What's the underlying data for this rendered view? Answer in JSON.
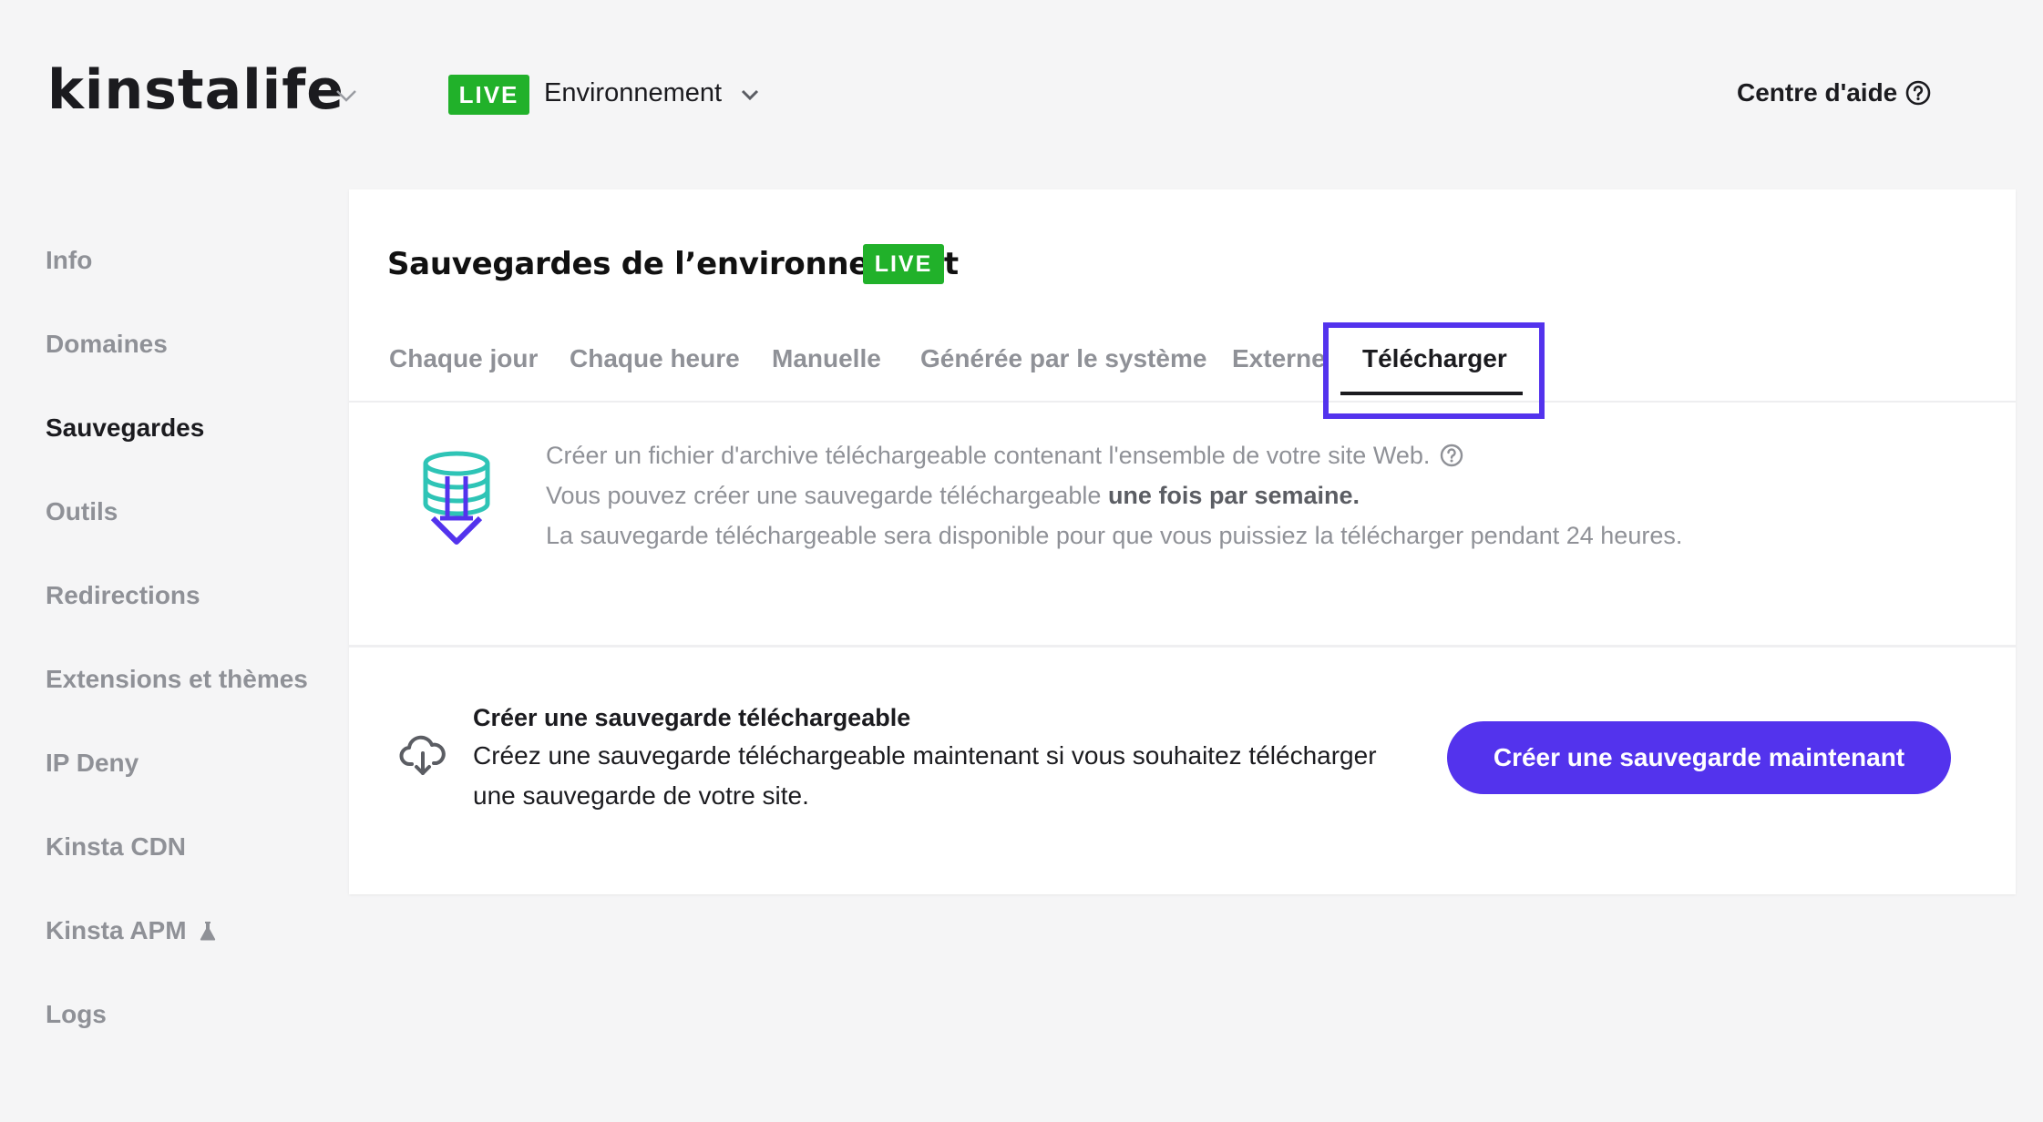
{
  "header": {
    "logo": "kinstalife",
    "live_badge": "LIVE",
    "environment_label": "Environnement",
    "help_label": "Centre d'aide"
  },
  "sidebar": {
    "items": [
      {
        "label": "Info"
      },
      {
        "label": "Domaines"
      },
      {
        "label": "Sauvegardes"
      },
      {
        "label": "Outils"
      },
      {
        "label": "Redirections"
      },
      {
        "label": "Extensions et thèmes"
      },
      {
        "label": "IP Deny"
      },
      {
        "label": "Kinsta CDN"
      },
      {
        "label": "Kinsta APM"
      },
      {
        "label": "Logs"
      }
    ],
    "active_index": 2
  },
  "main": {
    "title": "Sauvegardes de l’environnement",
    "live_badge": "LIVE",
    "tabs": [
      {
        "label": "Chaque jour"
      },
      {
        "label": "Chaque heure"
      },
      {
        "label": "Manuelle"
      },
      {
        "label": "Générée par le système"
      },
      {
        "label": "Externe"
      },
      {
        "label": "Télécharger"
      }
    ],
    "active_tab_index": 5,
    "info": {
      "line1": "Créer un fichier d'archive téléchargeable contenant l'ensemble de votre site Web.",
      "line2_prefix": "Vous pouvez créer une sauvegarde téléchargeable ",
      "line2_bold": "une fois par semaine.",
      "line3": "La sauvegarde téléchargeable sera disponible pour que vous puissiez la télécharger pendant 24 heures."
    },
    "create": {
      "title": "Créer une sauvegarde téléchargeable",
      "description": "Créez une sauvegarde téléchargeable maintenant si vous souhaitez télécharger une sauvegarde de votre site.",
      "button_label": "Créer une sauvegarde maintenant"
    }
  },
  "colors": {
    "accent": "#5333ed",
    "live_green": "#21b12a",
    "muted_text": "#8f9197",
    "background": "#f5f5f6"
  },
  "icons": {
    "logo_chevron": "chevron-down-icon",
    "env_chevron": "chevron-down-icon",
    "help": "question-circle-icon",
    "apm": "flask-icon",
    "archive": "database-download-icon",
    "info_help": "question-circle-icon",
    "create": "cloud-download-icon"
  }
}
